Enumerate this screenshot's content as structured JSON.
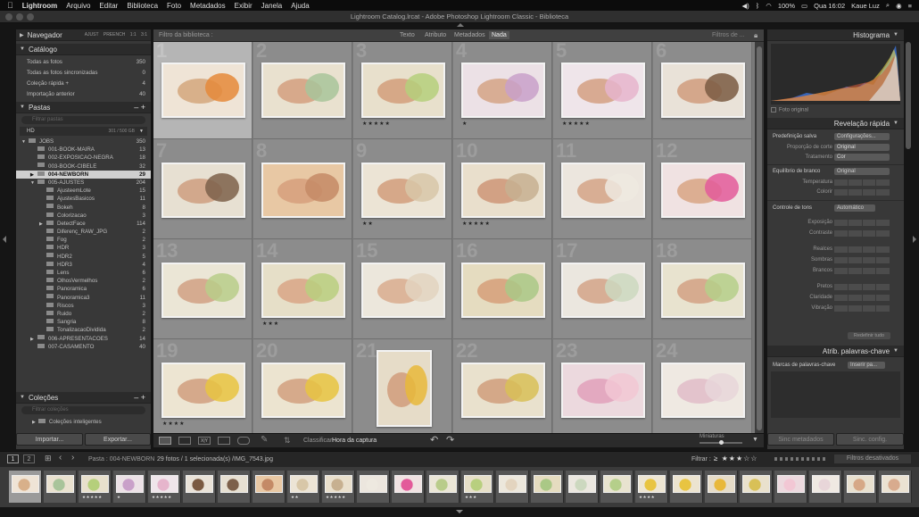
{
  "menubar": {
    "apple": "",
    "app": "Lightroom",
    "items": [
      "Arquivo",
      "Editar",
      "Biblioteca",
      "Foto",
      "Metadados",
      "Exibir",
      "Janela",
      "Ajuda"
    ],
    "battery": "100%",
    "time": "Qua 16:02",
    "user": "Kaue Luz"
  },
  "window": {
    "title": "Lightroom Catalog.lrcat - Adobe Photoshop Lightroom Classic - Biblioteca"
  },
  "left": {
    "navigator": {
      "title": "Navegador",
      "opts": [
        "AJUST",
        "PREENCH",
        "1:1",
        "3:1"
      ]
    },
    "catalog": {
      "title": "Catálogo",
      "items": [
        {
          "label": "Todas as fotos",
          "count": "350"
        },
        {
          "label": "Todas as fotos sincronizadas",
          "count": "0"
        },
        {
          "label": "Coleção rápida +",
          "count": "4"
        },
        {
          "label": "Importação anterior",
          "count": "40"
        }
      ]
    },
    "folders": {
      "title": "Pastas",
      "filter_placeholder": "Filtrar pastas",
      "volume": "HD",
      "volume_info": "301 / 500 GB",
      "items": [
        {
          "label": "JOBS",
          "count": "350",
          "indent": 1,
          "arrow": "▼"
        },
        {
          "label": "001-BOOK-MAIRA",
          "count": "13",
          "indent": 2,
          "arrow": ""
        },
        {
          "label": "002-EXPOSICAO-NEGRA",
          "count": "18",
          "indent": 2,
          "arrow": ""
        },
        {
          "label": "003-BOOK-CIBELE",
          "count": "32",
          "indent": 2,
          "arrow": ""
        },
        {
          "label": "004-NEWBORN",
          "count": "29",
          "indent": 2,
          "arrow": "▶",
          "selected": true
        },
        {
          "label": "005-AJUSTES",
          "count": "204",
          "indent": 2,
          "arrow": "▼"
        },
        {
          "label": "AjusteemLote",
          "count": "15",
          "indent": 3,
          "arrow": ""
        },
        {
          "label": "AjustesBasicos",
          "count": "11",
          "indent": 3,
          "arrow": ""
        },
        {
          "label": "Bokeh",
          "count": "8",
          "indent": 3,
          "arrow": ""
        },
        {
          "label": "Colorizacao",
          "count": "3",
          "indent": 3,
          "arrow": ""
        },
        {
          "label": "DetectFace",
          "count": "114",
          "indent": 3,
          "arrow": "▶"
        },
        {
          "label": "Diferenç_RAW_JPG",
          "count": "2",
          "indent": 3,
          "arrow": ""
        },
        {
          "label": "Fog",
          "count": "2",
          "indent": 3,
          "arrow": ""
        },
        {
          "label": "HDR",
          "count": "3",
          "indent": 3,
          "arrow": ""
        },
        {
          "label": "HDR2",
          "count": "5",
          "indent": 3,
          "arrow": ""
        },
        {
          "label": "HDR3",
          "count": "4",
          "indent": 3,
          "arrow": ""
        },
        {
          "label": "Lens",
          "count": "6",
          "indent": 3,
          "arrow": ""
        },
        {
          "label": "OlhosVermelhos",
          "count": "2",
          "indent": 3,
          "arrow": ""
        },
        {
          "label": "Panoramica",
          "count": "6",
          "indent": 3,
          "arrow": ""
        },
        {
          "label": "Panoramica3",
          "count": "11",
          "indent": 3,
          "arrow": ""
        },
        {
          "label": "Riscos",
          "count": "3",
          "indent": 3,
          "arrow": ""
        },
        {
          "label": "Ruido",
          "count": "2",
          "indent": 3,
          "arrow": ""
        },
        {
          "label": "Sangria",
          "count": "8",
          "indent": 3,
          "arrow": ""
        },
        {
          "label": "TonalizacaoDividida",
          "count": "2",
          "indent": 3,
          "arrow": ""
        },
        {
          "label": "006-APRESENTACOES",
          "count": "14",
          "indent": 2,
          "arrow": "▶"
        },
        {
          "label": "007-CASAMENTO",
          "count": "40",
          "indent": 2,
          "arrow": ""
        }
      ]
    },
    "collections": {
      "title": "Coleções",
      "filter_placeholder": "Filtrar coleções",
      "smart": "Coleções inteligentes"
    },
    "import_label": "Importar...",
    "export_label": "Exportar..."
  },
  "filterbar": {
    "title": "Filtro da biblioteca :",
    "tabs": [
      "Texto",
      "Atributo",
      "Metadados",
      "Nada"
    ],
    "active": "Nada",
    "preset": "Filtros de ..."
  },
  "grid": {
    "cells": [
      {
        "n": "1",
        "stars": "",
        "sel": true,
        "c": [
          "#efe4d6",
          "#d8b08a",
          "#e58a3a"
        ]
      },
      {
        "n": "2",
        "stars": "",
        "c": [
          "#e9e1cf",
          "#d7a98b",
          "#a8c49a"
        ]
      },
      {
        "n": "3",
        "stars": "★★★★★",
        "c": [
          "#e8e0cc",
          "#d6a887",
          "#b5cf7b"
        ]
      },
      {
        "n": "4",
        "stars": "★",
        "c": [
          "#ece1e6",
          "#d8ad94",
          "#c9a0c9"
        ]
      },
      {
        "n": "5",
        "stars": "★★★★★",
        "c": [
          "#efe5ea",
          "#d8aa92",
          "#e6b5cc"
        ]
      },
      {
        "n": "6",
        "stars": "",
        "c": [
          "#e9e2d8",
          "#d4a78b",
          "#7a5a42"
        ]
      },
      {
        "n": "7",
        "stars": "",
        "c": [
          "#e7e0d2",
          "#d2a88c",
          "#7d604a"
        ]
      },
      {
        "n": "8",
        "stars": "",
        "c": [
          "#e8c8a4",
          "#d9a582",
          "#c48a66"
        ]
      },
      {
        "n": "9",
        "stars": "★★",
        "c": [
          "#ece4d5",
          "#d6a889",
          "#d8c7a8"
        ]
      },
      {
        "n": "10",
        "stars": "★★★★★",
        "c": [
          "#e9dfcc",
          "#d2a184",
          "#c7b090"
        ]
      },
      {
        "n": "11",
        "stars": "",
        "c": [
          "#ece6de",
          "#d8ae94",
          "#eee9e0"
        ]
      },
      {
        "n": "12",
        "stars": "",
        "c": [
          "#f0e2e2",
          "#dcae92",
          "#e35a9a"
        ]
      },
      {
        "n": "13",
        "stars": "",
        "c": [
          "#ebe6d6",
          "#d5ab90",
          "#b9cc8a"
        ]
      },
      {
        "n": "14",
        "stars": "★★★",
        "c": [
          "#e6dfc8",
          "#dbae90",
          "#b8cf7f"
        ]
      },
      {
        "n": "15",
        "stars": "",
        "c": [
          "#ece7dc",
          "#dcb59a",
          "#e3d4bf"
        ]
      },
      {
        "n": "16",
        "stars": "",
        "c": [
          "#e5dcc0",
          "#d8a884",
          "#aac886"
        ]
      },
      {
        "n": "17",
        "stars": "",
        "c": [
          "#ebe7df",
          "#d7ae95",
          "#ccd8bf"
        ]
      },
      {
        "n": "18",
        "stars": "",
        "c": [
          "#e8e3cf",
          "#d6ab8f",
          "#b5cf8a"
        ]
      },
      {
        "n": "19",
        "stars": "★★★★",
        "c": [
          "#ede5d2",
          "#d5a98b",
          "#e8c441"
        ]
      },
      {
        "n": "20",
        "stars": "",
        "c": [
          "#ece4d0",
          "#d6aa8b",
          "#e8c441"
        ]
      },
      {
        "n": "21",
        "stars": "",
        "c": [
          "#e6dcc8",
          "#d4a687",
          "#e8b83a"
        ]
      },
      {
        "n": "22",
        "stars": "",
        "c": [
          "#e9e1cd",
          "#d4a888",
          "#d8c057"
        ]
      },
      {
        "n": "23",
        "stars": "",
        "c": [
          "#ecd9de",
          "#e3a9c0",
          "#f2c7d4"
        ]
      },
      {
        "n": "24",
        "stars": "",
        "c": [
          "#efe9e2",
          "#e3c3cc",
          "#e8d6d9"
        ]
      }
    ]
  },
  "toolbar": {
    "sort_label": "Classificar:",
    "sort_value": "Hora da captura",
    "thumbs_label": "Miniaturas"
  },
  "right": {
    "histogram": {
      "title": "Histograma",
      "original": "Foto original"
    },
    "quick": {
      "title": "Revelação rápida",
      "preset": {
        "label": "Predefinição salva",
        "value": "Configurações..."
      },
      "crop": {
        "label": "Proporção de corte",
        "value": "Original"
      },
      "treatment": {
        "label": "Tratamento",
        "value": "Cor"
      },
      "wb": {
        "label": "Equilíbrio de branco",
        "value": "Original"
      },
      "temp": "Temperatura",
      "tint": "Colorir",
      "tone": {
        "label": "Controle de tons",
        "value": "Automático"
      },
      "tone_rows": [
        "Exposição",
        "Contraste",
        "Realces",
        "Sombras",
        "Brancos",
        "Pretos",
        "Claridade",
        "Vibração"
      ],
      "reset": "Redefinir tudo"
    },
    "keywords": {
      "title": "Atrib. palavras-chave",
      "label": "Marcas de palavras-chave",
      "value": "Inserir pa..."
    },
    "sync_meta": "Sinc metadados",
    "sync_settings": "Sinc. config."
  },
  "filmhead": {
    "pages": [
      "1",
      "2"
    ],
    "path": "Pasta : 004-NEWBORN",
    "info": "29 fotos / 1 selecionada(s) /IMG_7543.jpg",
    "filter_label": "Filtrar :",
    "filters_off": "Filtros desativados"
  },
  "filmstrip": {
    "items": [
      {
        "c": [
          "#efe4d6",
          "#d8b08a"
        ],
        "st": ""
      },
      {
        "c": [
          "#e9e1cf",
          "#a8c49a"
        ],
        "st": ""
      },
      {
        "c": [
          "#e8e0cc",
          "#b5cf7b"
        ],
        "st": "★★★★★"
      },
      {
        "c": [
          "#ece1e6",
          "#c9a0c9"
        ],
        "st": "★"
      },
      {
        "c": [
          "#efe5ea",
          "#e6b5cc"
        ],
        "st": "★★★★★"
      },
      {
        "c": [
          "#e9e2d8",
          "#7a5a42"
        ],
        "st": ""
      },
      {
        "c": [
          "#e7e0d2",
          "#7d604a"
        ],
        "st": ""
      },
      {
        "c": [
          "#e8c8a4",
          "#c48a66"
        ],
        "st": ""
      },
      {
        "c": [
          "#ece4d5",
          "#d8c7a8"
        ],
        "st": "★★"
      },
      {
        "c": [
          "#e9dfcc",
          "#c7b090"
        ],
        "st": "★★★★★"
      },
      {
        "c": [
          "#ece6de",
          "#eee9e0"
        ],
        "st": ""
      },
      {
        "c": [
          "#f0e2e2",
          "#e35a9a"
        ],
        "st": ""
      },
      {
        "c": [
          "#ebe6d6",
          "#b9cc8a"
        ],
        "st": ""
      },
      {
        "c": [
          "#e6dfc8",
          "#b8cf7f"
        ],
        "st": "★★★"
      },
      {
        "c": [
          "#ece7dc",
          "#e3d4bf"
        ],
        "st": ""
      },
      {
        "c": [
          "#e5dcc0",
          "#aac886"
        ],
        "st": ""
      },
      {
        "c": [
          "#ebe7df",
          "#ccd8bf"
        ],
        "st": ""
      },
      {
        "c": [
          "#e8e3cf",
          "#b5cf8a"
        ],
        "st": ""
      },
      {
        "c": [
          "#ede5d2",
          "#e8c441"
        ],
        "st": "★★★★"
      },
      {
        "c": [
          "#ece4d0",
          "#e8c441"
        ],
        "st": ""
      },
      {
        "c": [
          "#e6dcc8",
          "#e8b83a"
        ],
        "st": ""
      },
      {
        "c": [
          "#e9e1cd",
          "#d8c057"
        ],
        "st": ""
      },
      {
        "c": [
          "#ecd9de",
          "#f2c7d4"
        ],
        "st": ""
      },
      {
        "c": [
          "#efe9e2",
          "#e8d6d9"
        ],
        "st": ""
      },
      {
        "c": [
          "#e8e0cf",
          "#d6a887"
        ],
        "st": ""
      },
      {
        "c": [
          "#ebe2d2",
          "#d8ab8e"
        ],
        "st": ""
      }
    ]
  },
  "colors": {
    "accent": "#cfcfcf",
    "panel": "#383838",
    "grid": "#7a7a7a"
  }
}
